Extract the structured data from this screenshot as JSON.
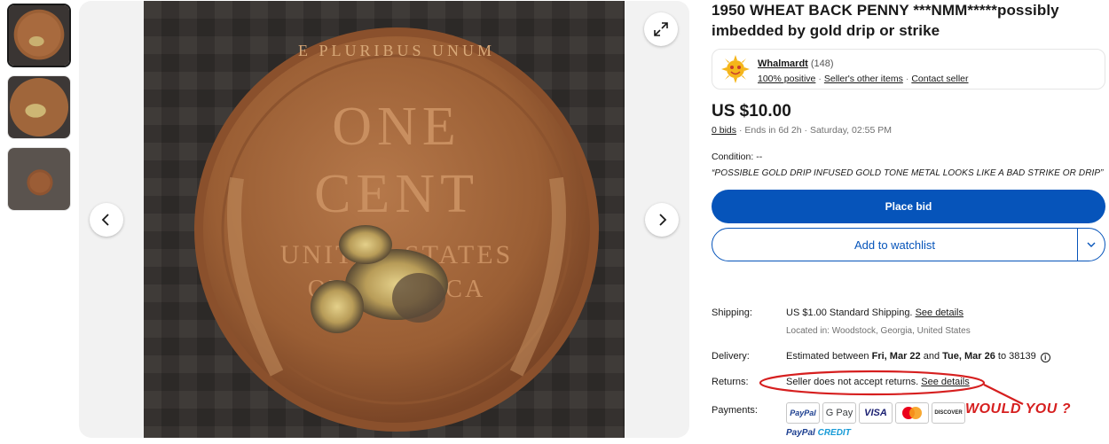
{
  "gallery": {
    "expand_icon": "expand-icon",
    "prev_icon": "chevron-left-icon",
    "next_icon": "chevron-right-icon",
    "thumbnail_count": 3,
    "coin_legend_top": "E PLURIBUS UNUM",
    "coin_line1": "ONE",
    "coin_line2": "CENT",
    "coin_line3": "UNITED STATES",
    "coin_line4": "OF AMERICA"
  },
  "listing": {
    "title": "1950 WHEAT BACK PENNY ***NMM*****possibly imbedded by gold drip or strike"
  },
  "seller": {
    "name": "Whalmardt",
    "feedback_count": "(148)",
    "positive": "100% positive",
    "other_items": "Seller's other items",
    "contact": "Contact seller"
  },
  "price": {
    "amount": "US $10.00",
    "bids": "0 bids",
    "ends": "Ends in 6d 2h",
    "end_time": "Saturday, 02:55 PM"
  },
  "condition": {
    "label": "Condition:",
    "value": "--",
    "description": "“POSSIBLE GOLD DRIP INFUSED GOLD TONE METAL LOOKS LIKE A BAD STRIKE OR DRIP”"
  },
  "actions": {
    "place_bid": "Place bid",
    "watchlist": "Add to watchlist"
  },
  "shipping": {
    "label": "Shipping:",
    "cost": "US $1.00 Standard Shipping.",
    "see_details": "See details",
    "location": "Located in: Woodstock, Georgia, United States"
  },
  "delivery": {
    "label": "Delivery:",
    "text_prefix": "Estimated between ",
    "date1": "Fri, Mar 22",
    "and": " and ",
    "date2": "Tue, Mar 26",
    "text_suffix": " to 38139"
  },
  "returns": {
    "label": "Returns:",
    "text": "Seller does not accept returns.",
    "see_details": "See details"
  },
  "payments": {
    "label": "Payments:",
    "methods": [
      "PayPal",
      "G Pay",
      "VISA",
      "Mastercard",
      "DISCOVER"
    ],
    "paypal_credit_a": "PayPal",
    "paypal_credit_b": "CREDIT"
  },
  "annotation": {
    "text": "WOULD YOU ?",
    "color": "#d61f1f"
  },
  "colors": {
    "primary": "#0654ba",
    "text": "#191919",
    "muted": "#707070"
  }
}
